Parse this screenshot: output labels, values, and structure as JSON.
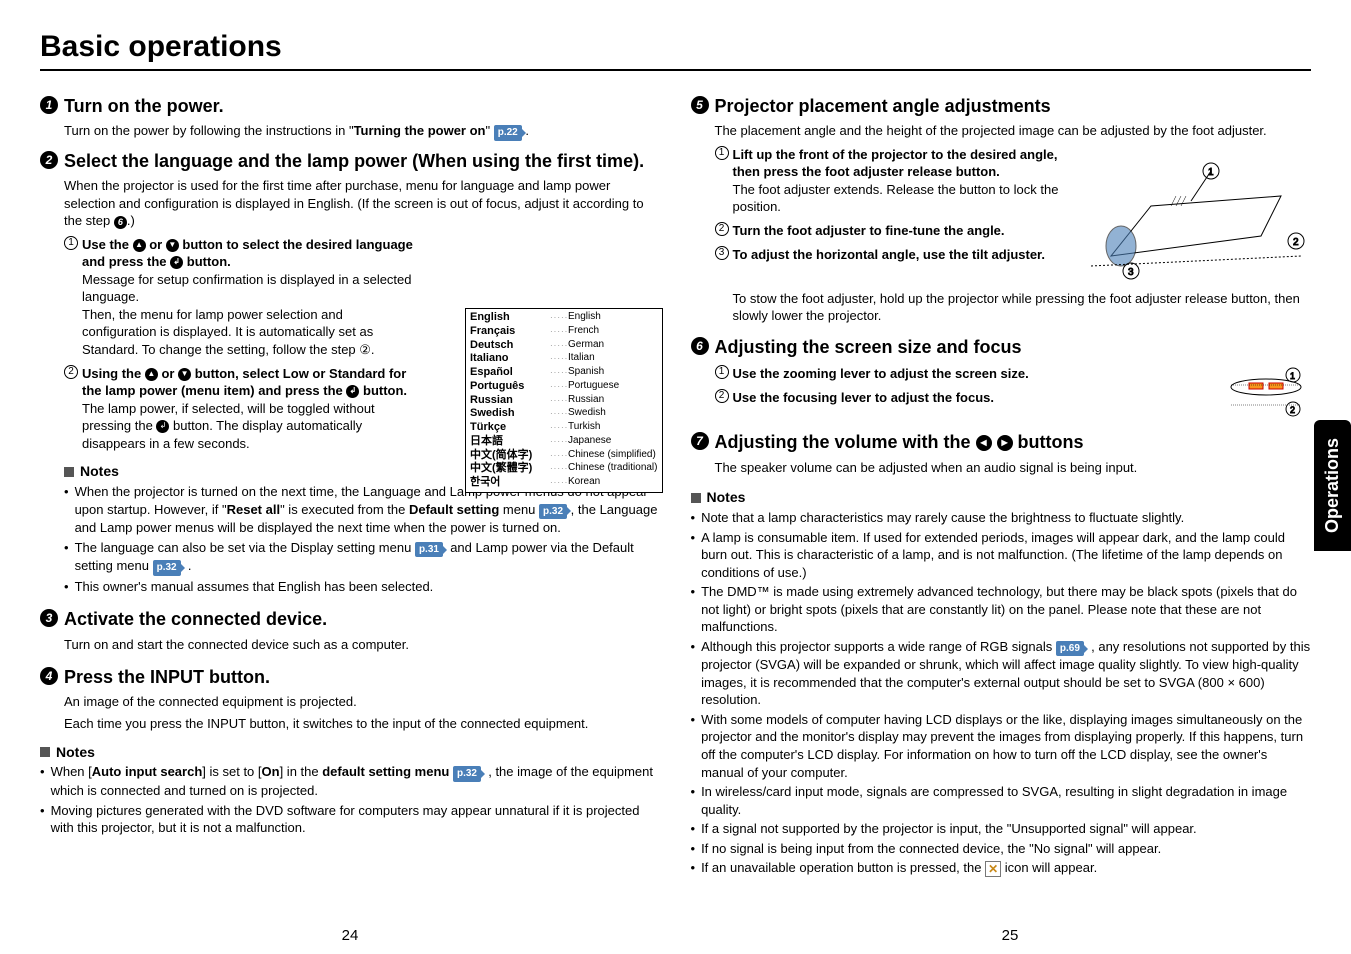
{
  "page_title": "Basic operations",
  "side_tab": "Operations",
  "page_left": "24",
  "page_right": "25",
  "s1": {
    "num": "1",
    "title": "Turn on the power.",
    "body_a": "Turn on the power by following the instructions in \"",
    "body_b": "Turning the power on",
    "body_c": "\" ",
    "ref": "p.22"
  },
  "s2": {
    "num": "2",
    "title": "Select the language and the lamp power (When using the first time).",
    "body": "When the projector is used for the first time after purchase, menu for language and lamp power selection and configuration is displayed in English. (If the screen is out of focus, adjust it according to the step ",
    "body_end": ".)",
    "step_ref": "6",
    "sub1": {
      "n": "1",
      "title_a": "Use the ",
      "title_b": " or ",
      "title_c": " button to select the desired language and press the ",
      "title_d": " button.",
      "body": "Message for setup confirmation is displayed in a selected language.",
      "body2": "Then, the menu for lamp power selection and configuration is displayed. It is automatically set as Standard. To change the setting, follow the step ②."
    },
    "sub2": {
      "n": "2",
      "title_a": "Using the ",
      "title_b": " or ",
      "title_c": " button, select Low or Standard for the lamp power (menu item) and press the ",
      "title_d": " button.",
      "body": "The lamp power, if selected, will be toggled without pressing the ",
      "body2": " button. The display automatically disappears in a few seconds."
    },
    "notes_title": "Notes",
    "note1_a": "When the projector is turned on the next time, the Language and Lamp power menus do not appear upon startup. However, if \"",
    "note1_b": "Reset all",
    "note1_c": "\" is executed from the ",
    "note1_d": "Default setting",
    "note1_e": " menu ",
    "note1_f": ", the Language and Lamp power menus will be displayed the next time when the power is turned on.",
    "note1_ref": "p.32",
    "note2_a": "The language can also be set via the Display setting menu ",
    "note2_b": " and Lamp power via the Default setting menu ",
    "note2_c": " .",
    "note2_ref1": "p.31",
    "note2_ref2": "p.32",
    "note3": "This owner's manual assumes that English has been selected."
  },
  "s3": {
    "num": "3",
    "title": "Activate the connected device.",
    "body": "Turn on and start the connected device such as a computer."
  },
  "s4": {
    "num": "4",
    "title": "Press the INPUT button.",
    "body": "An image of the connected equipment is projected.",
    "body2": "Each time you press the INPUT button, it switches to the input of the connected equipment.",
    "notes_title": "Notes",
    "note1_a": "When [",
    "note1_b": "Auto input search",
    "note1_c": "] is set to [",
    "note1_d": "On",
    "note1_e": "] in the ",
    "note1_f": "default setting menu",
    "note1_g": " , the image of the equipment which is connected and turned on is projected.",
    "note1_ref": "p.32",
    "note2": "Moving pictures generated with the DVD software for computers may appear unnatural if it is projected with this projector, but it is not a malfunction."
  },
  "s5": {
    "num": "5",
    "title": "Projector placement angle adjustments",
    "body": "The placement angle and the height of the projected image can be adjusted by the foot adjuster.",
    "sub1": {
      "n": "1",
      "title": "Lift up the front of the projector to the desired angle, then press the foot adjuster release button.",
      "body": "The foot adjuster extends. Release the button to lock the position."
    },
    "sub2": {
      "n": "2",
      "title": "Turn the foot adjuster to fine-tune the angle."
    },
    "sub3": {
      "n": "3",
      "title": "To adjust the horizontal angle, use the tilt adjuster."
    },
    "body2": "To stow the foot adjuster, hold up the projector while pressing the foot adjuster release button, then slowly lower the projector."
  },
  "s6": {
    "num": "6",
    "title": "Adjusting the screen size and focus",
    "sub1": {
      "n": "1",
      "title": "Use the zooming lever to adjust the screen size."
    },
    "sub2": {
      "n": "2",
      "title": "Use the focusing lever to adjust the focus."
    }
  },
  "s7": {
    "num": "7",
    "title_a": "Adjusting the volume with the ",
    "title_b": " buttons",
    "body": "The speaker volume can be adjusted when an audio signal is being input.",
    "notes_title": "Notes",
    "n1": "Note that a lamp characteristics may rarely cause the brightness to fluctuate slightly.",
    "n2": "A lamp is consumable item. If used for extended periods, images will appear dark, and the lamp could burn out.  This is characteristic of a lamp, and is not malfunction. (The lifetime of the lamp depends on conditions of use.)",
    "n3": "The DMD™ is made using extremely advanced technology, but there may be black spots (pixels that do not light) or bright spots (pixels that are constantly lit) on the panel.  Please note that these are not malfunctions.",
    "n4_a": "Although this projector supports a wide range of RGB signals ",
    "n4_b": " , any resolutions not supported by this projector (SVGA) will be expanded or shrunk, which will affect image quality slightly. To view high-quality images, it is recommended that the computer's external output should be set to SVGA (800 × 600) resolution.",
    "n4_ref": "p.69",
    "n5": "With some models of computer having LCD displays or the like, displaying images simultaneously on the projector and the monitor's display may prevent the images from displaying properly. If this happens, turn off the computer's LCD display. For information on how to turn off the LCD display, see the owner's manual of your computer.",
    "n6": "In wireless/card input mode, signals are compressed to SVGA, resulting in slight degradation in image quality.",
    "n7": "If a signal not supported by the projector is input, the \"Unsupported signal\" will appear.",
    "n8": "If no signal is being input from the connected device, the \"No signal\" will appear.",
    "n9_a": "If an unavailable operation button is pressed, the ",
    "n9_b": " icon will appear."
  },
  "languages": [
    {
      "native": "English",
      "eng": "English"
    },
    {
      "native": "Français",
      "eng": "French"
    },
    {
      "native": "Deutsch",
      "eng": "German"
    },
    {
      "native": "Italiano",
      "eng": "Italian"
    },
    {
      "native": "Español",
      "eng": "Spanish"
    },
    {
      "native": "Português",
      "eng": "Portuguese"
    },
    {
      "native": "Russian",
      "eng": "Russian"
    },
    {
      "native": "Swedish",
      "eng": "Swedish"
    },
    {
      "native": "Türkçe",
      "eng": "Turkish"
    },
    {
      "native": "日本語",
      "eng": "Japanese"
    },
    {
      "native": "中文(简体字)",
      "eng": "Chinese (simplified)"
    },
    {
      "native": "中文(繁體字)",
      "eng": "Chinese (traditional)"
    },
    {
      "native": "한국어",
      "eng": "Korean"
    }
  ]
}
